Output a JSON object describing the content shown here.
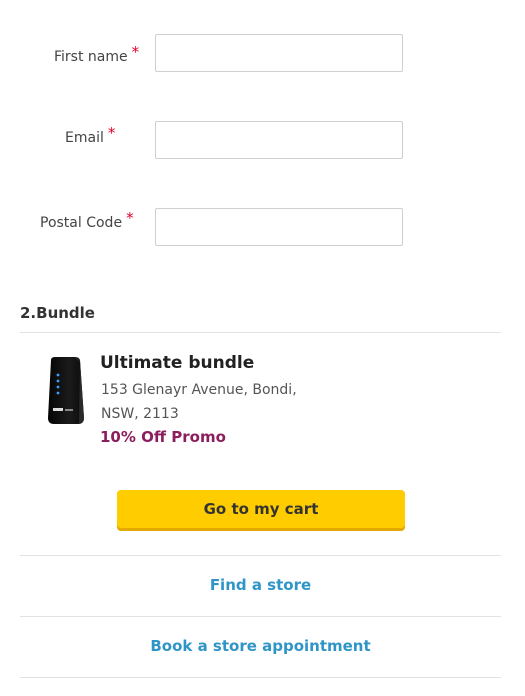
{
  "form": {
    "first_name": {
      "label": "First name",
      "required_mark": "*",
      "value": ""
    },
    "email": {
      "label": "Email",
      "required_mark": "*",
      "value": ""
    },
    "postal_code": {
      "label": "Postal Code",
      "required_mark": "*",
      "value": ""
    }
  },
  "bundle_section": {
    "title": "2.Bundle",
    "product": {
      "name": "Ultimate bundle",
      "address_line1": "153 Glenayr Avenue, Bondi,",
      "address_line2": "NSW, 2113",
      "promo": "10% Off Promo",
      "image_icon": "modem-device-icon"
    }
  },
  "actions": {
    "cart_button": "Go to my cart",
    "find_store_link": "Find a store",
    "book_appointment_link": "Book a store appointment"
  },
  "colors": {
    "required": "#e4002b",
    "promo": "#8b1e5e",
    "button_bg": "#ffcc00",
    "link": "#2f95c8"
  }
}
